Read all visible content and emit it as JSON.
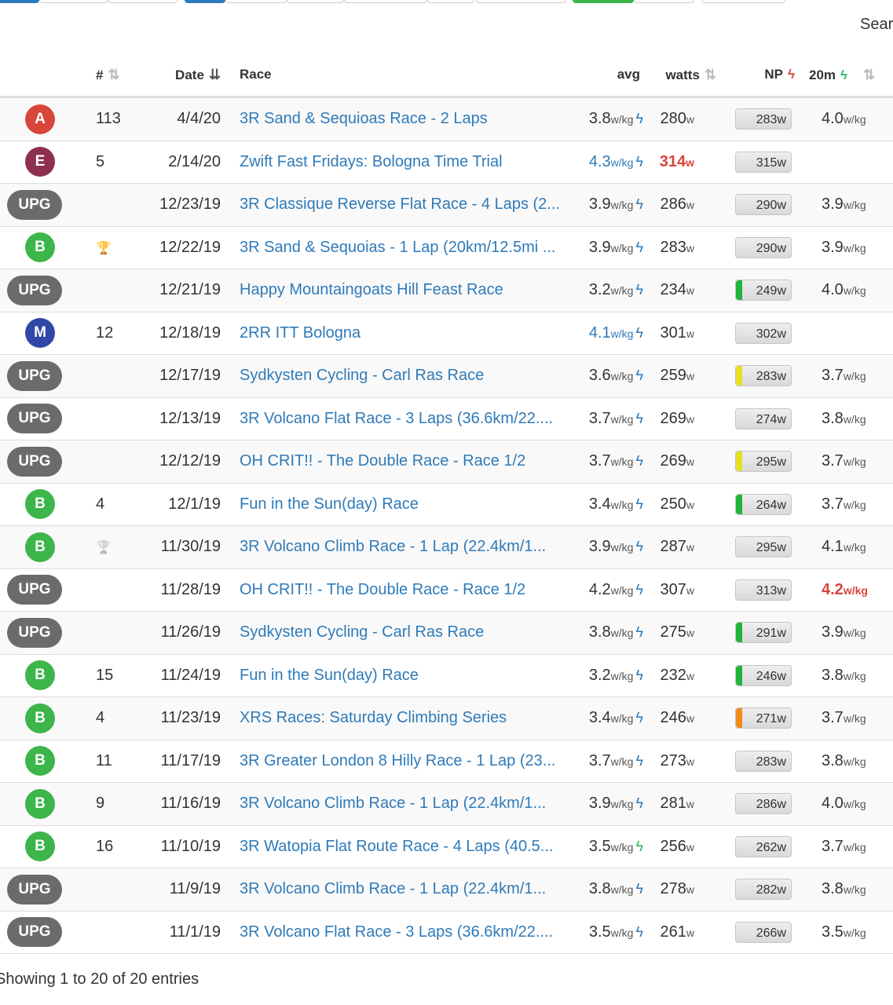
{
  "search": {
    "label": "Sear"
  },
  "columns": {
    "num": "#",
    "date": "Date",
    "race": "Race",
    "avg": "avg",
    "watts": "watts",
    "np": "NP",
    "twenty": "20m"
  },
  "colors": {
    "cat_A": "#d9463b",
    "cat_E": "#8e2f52",
    "cat_B": "#3cb54a",
    "cat_M": "#3047a8",
    "cat_UPG": "#6b6b6b",
    "link": "#2f7ab8",
    "highlight_red": "#d9433a",
    "bolt_blue": "#2f7ab8",
    "bolt_green": "#2dbd5a",
    "bolt_red": "#e0453a",
    "np_green": "#22b33a",
    "np_yellow": "#e6e022",
    "np_orange": "#f08a1a"
  },
  "rows": [
    {
      "cat": "A",
      "num": "113",
      "date": "4/4/20",
      "race": "3R Sand & Sequioas Race - 2 Laps",
      "avg": "3.8",
      "avg_unit": "w/kg",
      "watts": "280",
      "watts_unit": "w",
      "np": "283w",
      "np_bar": "",
      "twenty": "4.0",
      "twenty_unit": "w/kg"
    },
    {
      "cat": "E",
      "num": "5",
      "date": "2/14/20",
      "race": "Zwift Fast Fridays: Bologna Time Trial",
      "avg": "4.3",
      "avg_unit": "w/kg",
      "avg_blue": true,
      "watts": "314",
      "watts_unit": "w",
      "watts_red": true,
      "np": "315w",
      "np_bar": "",
      "twenty": "",
      "twenty_unit": ""
    },
    {
      "cat": "UPG",
      "num": "",
      "date": "12/23/19",
      "race": "3R Classique Reverse Flat Race - 4 Laps (2...",
      "avg": "3.9",
      "avg_unit": "w/kg",
      "watts": "286",
      "watts_unit": "w",
      "np": "290w",
      "np_bar": "",
      "twenty": "3.9",
      "twenty_unit": "w/kg"
    },
    {
      "cat": "B",
      "num": "",
      "trophy": "gold",
      "date": "12/22/19",
      "race": "3R Sand & Sequoias - 1 Lap (20km/12.5mi ...",
      "avg": "3.9",
      "avg_unit": "w/kg",
      "watts": "283",
      "watts_unit": "w",
      "np": "290w",
      "np_bar": "",
      "twenty": "3.9",
      "twenty_unit": "w/kg"
    },
    {
      "cat": "UPG",
      "num": "",
      "date": "12/21/19",
      "race": "Happy Mountaingoats Hill Feast Race",
      "avg": "3.2",
      "avg_unit": "w/kg",
      "watts": "234",
      "watts_unit": "w",
      "np": "249w",
      "np_bar": "green",
      "twenty": "4.0",
      "twenty_unit": "w/kg"
    },
    {
      "cat": "M",
      "num": "12",
      "date": "12/18/19",
      "race": "2RR ITT Bologna",
      "avg": "4.1",
      "avg_unit": "w/kg",
      "avg_blue": true,
      "watts": "301",
      "watts_unit": "w",
      "np": "302w",
      "np_bar": "",
      "twenty": "",
      "twenty_unit": ""
    },
    {
      "cat": "UPG",
      "num": "",
      "date": "12/17/19",
      "race": "Sydkysten Cycling - Carl Ras Race",
      "avg": "3.6",
      "avg_unit": "w/kg",
      "watts": "259",
      "watts_unit": "w",
      "np": "283w",
      "np_bar": "yellow",
      "twenty": "3.7",
      "twenty_unit": "w/kg"
    },
    {
      "cat": "UPG",
      "num": "",
      "date": "12/13/19",
      "race": "3R Volcano Flat Race - 3 Laps (36.6km/22....",
      "avg": "3.7",
      "avg_unit": "w/kg",
      "watts": "269",
      "watts_unit": "w",
      "np": "274w",
      "np_bar": "",
      "twenty": "3.8",
      "twenty_unit": "w/kg"
    },
    {
      "cat": "UPG",
      "num": "",
      "date": "12/12/19",
      "race": "OH CRIT!! - The Double Race - Race 1/2",
      "avg": "3.7",
      "avg_unit": "w/kg",
      "watts": "269",
      "watts_unit": "w",
      "np": "295w",
      "np_bar": "yellow",
      "twenty": "3.7",
      "twenty_unit": "w/kg"
    },
    {
      "cat": "B",
      "num": "4",
      "date": "12/1/19",
      "race": "Fun in the Sun(day) Race",
      "avg": "3.4",
      "avg_unit": "w/kg",
      "watts": "250",
      "watts_unit": "w",
      "np": "264w",
      "np_bar": "green",
      "twenty": "3.7",
      "twenty_unit": "w/kg"
    },
    {
      "cat": "B",
      "num": "",
      "trophy": "silver",
      "date": "11/30/19",
      "race": "3R Volcano Climb Race - 1 Lap (22.4km/1...",
      "avg": "3.9",
      "avg_unit": "w/kg",
      "watts": "287",
      "watts_unit": "w",
      "np": "295w",
      "np_bar": "",
      "twenty": "4.1",
      "twenty_unit": "w/kg"
    },
    {
      "cat": "UPG",
      "num": "",
      "date": "11/28/19",
      "race": "OH CRIT!! - The Double Race - Race 1/2",
      "avg": "4.2",
      "avg_unit": "w/kg",
      "watts": "307",
      "watts_unit": "w",
      "np": "313w",
      "np_bar": "",
      "twenty": "4.2",
      "twenty_unit": "w/kg",
      "twenty_red": true
    },
    {
      "cat": "UPG",
      "num": "",
      "date": "11/26/19",
      "race": "Sydkysten Cycling - Carl Ras Race",
      "avg": "3.8",
      "avg_unit": "w/kg",
      "watts": "275",
      "watts_unit": "w",
      "np": "291w",
      "np_bar": "green",
      "twenty": "3.9",
      "twenty_unit": "w/kg"
    },
    {
      "cat": "B",
      "num": "15",
      "date": "11/24/19",
      "race": "Fun in the Sun(day) Race",
      "avg": "3.2",
      "avg_unit": "w/kg",
      "watts": "232",
      "watts_unit": "w",
      "np": "246w",
      "np_bar": "green",
      "twenty": "3.8",
      "twenty_unit": "w/kg"
    },
    {
      "cat": "B",
      "num": "4",
      "date": "11/23/19",
      "race": "XRS Races: Saturday Climbing Series",
      "avg": "3.4",
      "avg_unit": "w/kg",
      "watts": "246",
      "watts_unit": "w",
      "np": "271w",
      "np_bar": "orange",
      "twenty": "3.7",
      "twenty_unit": "w/kg"
    },
    {
      "cat": "B",
      "num": "11",
      "date": "11/17/19",
      "race": "3R Greater London 8 Hilly Race - 1 Lap (23...",
      "avg": "3.7",
      "avg_unit": "w/kg",
      "watts": "273",
      "watts_unit": "w",
      "np": "283w",
      "np_bar": "",
      "twenty": "3.8",
      "twenty_unit": "w/kg"
    },
    {
      "cat": "B",
      "num": "9",
      "date": "11/16/19",
      "race": "3R Volcano Climb Race - 1 Lap (22.4km/1...",
      "avg": "3.9",
      "avg_unit": "w/kg",
      "watts": "281",
      "watts_unit": "w",
      "np": "286w",
      "np_bar": "",
      "twenty": "4.0",
      "twenty_unit": "w/kg"
    },
    {
      "cat": "B",
      "num": "16",
      "date": "11/10/19",
      "race": "3R Watopia Flat Route Race - 4 Laps (40.5...",
      "avg": "3.5",
      "avg_unit": "w/kg",
      "bolt": "green",
      "watts": "256",
      "watts_unit": "w",
      "np": "262w",
      "np_bar": "",
      "twenty": "3.7",
      "twenty_unit": "w/kg"
    },
    {
      "cat": "UPG",
      "num": "",
      "date": "11/9/19",
      "race": "3R Volcano Climb Race - 1 Lap (22.4km/1...",
      "avg": "3.8",
      "avg_unit": "w/kg",
      "watts": "278",
      "watts_unit": "w",
      "np": "282w",
      "np_bar": "",
      "twenty": "3.8",
      "twenty_unit": "w/kg"
    },
    {
      "cat": "UPG",
      "num": "",
      "date": "11/1/19",
      "race": "3R Volcano Flat Race - 3 Laps (36.6km/22....",
      "avg": "3.5",
      "avg_unit": "w/kg",
      "watts": "261",
      "watts_unit": "w",
      "np": "266w",
      "np_bar": "",
      "twenty": "3.5",
      "twenty_unit": "w/kg"
    }
  ],
  "footer": {
    "info": "Showing 1 to 20 of 20 entries"
  }
}
